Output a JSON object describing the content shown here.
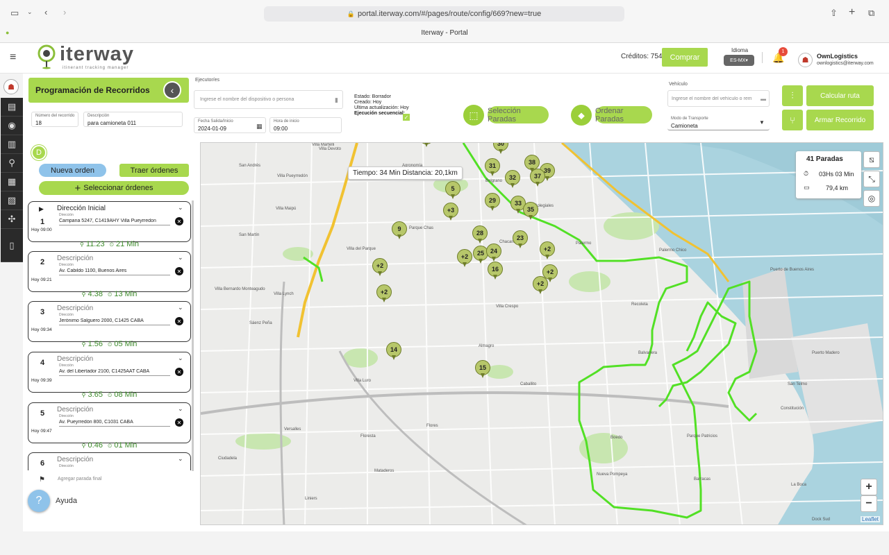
{
  "browser": {
    "url": "portal.iterway.com/#/pages/route/config/669?new=true",
    "tab_title": "Iterway - Portal"
  },
  "header": {
    "logo_text": "iterway",
    "logo_tagline": "itinerant tracking manager",
    "credits_label": "Créditos: 754",
    "buy_label": "Comprar",
    "language_label": "Idioma",
    "language_value": "ES-MX",
    "notifications_count": "1",
    "user_name": "OwnLogistics",
    "user_email": "ownlogistics@iterway.com"
  },
  "form": {
    "title": "Programación de Recorridos",
    "route_number_label": "Número del recorrido",
    "route_number": "18",
    "description_label": "Descripción",
    "description": "para camioneta 011",
    "executor_label": "Ejecutor/es",
    "executor_placeholder": "Ingrese el nombre del dispositivo o persona",
    "departure_label": "Fecha Salida/Inicio",
    "departure_date": "2024-01-09",
    "start_time_label": "Hora de inicio",
    "start_time": "09:00",
    "status": "Estado: Borrador",
    "created": "Creado: Hoy",
    "last_update": "Ultima actualización: Hoy",
    "sequential": "Ejecución secuencial:",
    "select_stops": "Selección Paradas",
    "order_stops": "Ordenar Paradas",
    "vehicle_label": "Vehículo",
    "vehicle_placeholder": "Ingrese el nombre del vehículo o rem",
    "transport_label": "Modo de Transporte",
    "transport_value": "Camioneta",
    "calc_route": "Calcular ruta",
    "build_route": "Armar Recorrido"
  },
  "orders": {
    "badge": "D",
    "new_order": "Nueva orden",
    "bring_orders": "Traer órdenes",
    "select_orders": "Seleccionar órdenes",
    "address_label": "Dirección",
    "stops": [
      {
        "num": "1",
        "title": "Dirección Inicial",
        "address": "Campana 5247,  C1419AHY Villa Pueyrredon",
        "time": "Hoy 09:00",
        "dist": "11.23",
        "dur": "21 Min"
      },
      {
        "num": "2",
        "title": "Descripción",
        "address": "Av. Cabildo 1100,  Buenos Aires",
        "time": "Hoy 09:21",
        "dist": "4.38",
        "dur": "13 Min"
      },
      {
        "num": "3",
        "title": "Descripción",
        "address": "Jerónimo Salguero 2000,  C1425 CABA",
        "time": "Hoy 09:34",
        "dist": "1.56",
        "dur": "05 Min"
      },
      {
        "num": "4",
        "title": "Descripción",
        "address": "Av. del Libertador 2100,  C1425AAT CABA",
        "time": "Hoy 09:39",
        "dist": "3.65",
        "dur": "08 Min"
      },
      {
        "num": "5",
        "title": "Descripción",
        "address": "Av. Pueyrredón 800,  C1031 CABA",
        "time": "Hoy 09:47",
        "dist": "0.46",
        "dur": "01 Min"
      },
      {
        "num": "6",
        "title": "Descripción",
        "address": "",
        "time": "",
        "dist": "",
        "dur": ""
      }
    ],
    "add_final": "Agregar parada final",
    "help": "Ayuda"
  },
  "map": {
    "tooltip": "Tiempo: 34 Min Distancia: 20,1km",
    "summary_stops": "41 Paradas",
    "summary_time": "03Hs 03 Min",
    "summary_dist": "79,4 km",
    "attribution": "Leaflet",
    "zoom_in": "+",
    "zoom_out": "−",
    "labels": [
      "Villa Martelli",
      "San Andrés",
      "Villa Maipú",
      "San Martín",
      "Villa Lynch",
      "Villa Bernardo Monteagudo",
      "Sáenz Peña",
      "Villa Devoto",
      "Villa Urquiza",
      "Villa Pueyrredón",
      "Belgrano",
      "Colegiales",
      "Palermo",
      "Palermo Chico",
      "Recoleta",
      "Villa Crespo",
      "Almagro",
      "Caballito",
      "Flores",
      "Floresta",
      "Boedo",
      "Parque Patricios",
      "Barracas",
      "Nueva Pompeya",
      "Liniers",
      "Ciudadela",
      "Mataderos",
      "Villa Luro",
      "Versalles",
      "Agronomía",
      "Puerto Madero",
      "La Boca",
      "Constitución",
      "San Telmo",
      "Balvanera",
      "Villa del Parque",
      "Parque Chas",
      "Chacarita",
      "Puerto de Buenos Aires",
      "Dock Sud"
    ],
    "pins": [
      "2",
      "4",
      "3",
      "+3",
      "30",
      "31",
      "38",
      "39",
      "37",
      "32",
      "5",
      "29",
      "33",
      "35",
      "+3",
      "9",
      "28",
      "23",
      "+2",
      "25",
      "24",
      "+2",
      "16",
      "+2",
      "+2",
      "+2",
      "+2",
      "14",
      "15"
    ]
  },
  "colors": {
    "accent": "#a8d84e",
    "route": "#52e025",
    "highway": "#f1c232"
  }
}
